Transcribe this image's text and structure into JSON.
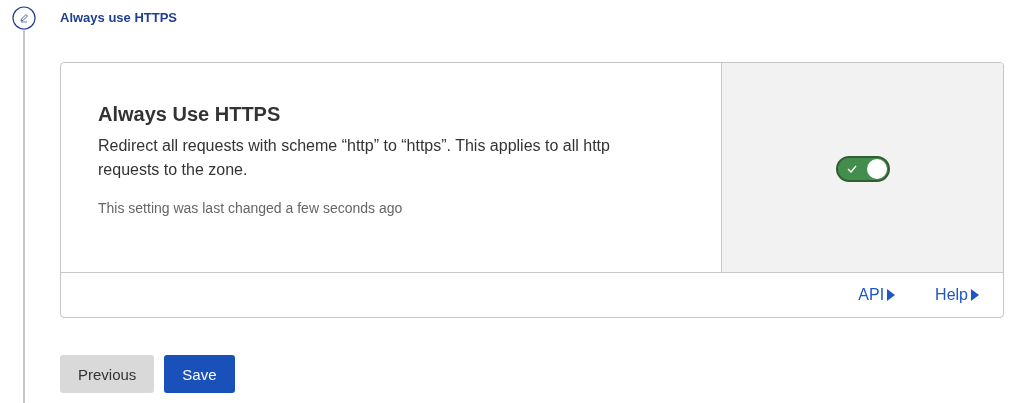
{
  "step": {
    "title": "Always use HTTPS"
  },
  "setting": {
    "title": "Always Use HTTPS",
    "description": "Redirect all requests with scheme “http” to “https”. This applies to all http requests to the zone.",
    "note": "This setting was last changed a few seconds ago",
    "toggle": {
      "on": true
    }
  },
  "links": [
    {
      "label": "API"
    },
    {
      "label": "Help"
    }
  ],
  "buttons": [
    {
      "label": "Previous",
      "kind": "secondary"
    },
    {
      "label": "Save",
      "kind": "primary"
    }
  ]
}
